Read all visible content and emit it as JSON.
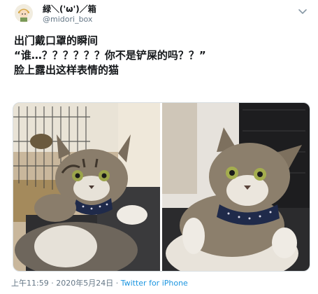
{
  "user": {
    "display_name": "緑＼('ω')／箱",
    "handle": "@midori_box"
  },
  "tweet": {
    "lines": [
      "出门戴口罩的瞬间",
      "“谁…？？？？？？你不是铲屎的吗？？”",
      "脸上露出这样表情的猫"
    ]
  },
  "media": {
    "photos": [
      {
        "subject": "tabby cat with bow tie on chair, left"
      },
      {
        "subject": "tabby cat with bow tie on chair, right"
      }
    ]
  },
  "meta": {
    "time": "上午11:59",
    "separator1": " · ",
    "date": "2020年5月24日",
    "separator2": " · ",
    "source": "Twitter for iPhone"
  },
  "icons": {
    "more": "chevron-down-icon",
    "avatar": "avatar"
  },
  "colors": {
    "text_primary": "#14171a",
    "text_secondary": "#657786",
    "link": "#1b95e0"
  }
}
